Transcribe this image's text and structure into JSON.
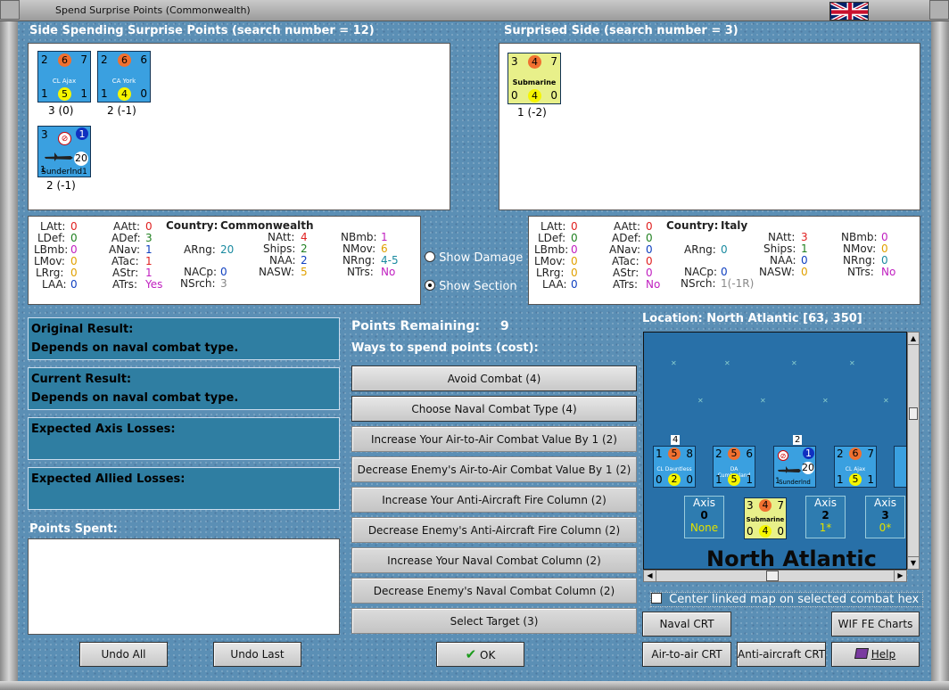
{
  "window": {
    "title": "Spend Surprise Points (Commonwealth)"
  },
  "spending": {
    "header": "Side Spending Surprise Points (search number = 12)",
    "units": [
      {
        "name": "CL Ajax",
        "top": [
          "2",
          "6",
          "7"
        ],
        "bottom": [
          "1",
          "5",
          "1"
        ],
        "count": "3 (0)"
      },
      {
        "name": "CA York",
        "top": [
          "2",
          "6",
          "6"
        ],
        "bottom": [
          "1",
          "4",
          "0"
        ],
        "count": "2 (-1)"
      },
      {
        "name": "Sunderlnd1",
        "top": [
          "3",
          "",
          "1"
        ],
        "bottom": [
          "1",
          "20",
          ""
        ],
        "count": "2 (-1)"
      }
    ]
  },
  "surprised": {
    "header": "Surprised Side (search number = 3)",
    "units": [
      {
        "name": "Submarine",
        "top": [
          "3",
          "4",
          "7"
        ],
        "bottom": [
          "0",
          "4",
          "0"
        ],
        "count": "1 (-2)"
      }
    ]
  },
  "left_stats": {
    "country_label": "Country:",
    "country": "Commonwealth",
    "rows": [
      [
        "LAtt:",
        "0",
        "AAtt:",
        "0",
        "NAtt:",
        "4",
        "NBmb:",
        "1"
      ],
      [
        "LDef:",
        "0",
        "ADef:",
        "3",
        "ARng:",
        "20",
        "Ships:",
        "2",
        "NMov:",
        "6"
      ],
      [
        "LBmb:",
        "0",
        "ANav:",
        "1",
        "NAA:",
        "2",
        "NRng:",
        "4-5"
      ],
      [
        "LMov:",
        "0",
        "ATac:",
        "1",
        "NACp:",
        "0",
        "NASW:",
        "5",
        "NTrs:",
        "No"
      ],
      [
        "LRrg:",
        "0",
        "AStr:",
        "1",
        "NSrch:",
        "3"
      ],
      [
        "LAA:",
        "0",
        "ATrs:",
        "Yes"
      ]
    ]
  },
  "right_stats": {
    "country_label": "Country:",
    "country": "Italy"
  },
  "ls": {
    "LAtt": "LAtt:",
    "LAttv": "0",
    "AAtt": "AAtt:",
    "AAttv": "0",
    "NAtt": "NAtt:",
    "NAttv": "4",
    "NBmb": "NBmb:",
    "NBmbv": "1",
    "LDef": "LDef:",
    "LDefv": "0",
    "ADef": "ADef:",
    "ADefv": "3",
    "Ships": "Ships:",
    "Shipsv": "2",
    "NMov": "NMov:",
    "NMovv": "6",
    "LBmb": "LBmb:",
    "LBmbv": "0",
    "ANav": "ANav:",
    "ANavv": "1",
    "ARng": "ARng:",
    "ARngv": "20",
    "NAA": "NAA:",
    "NAAv": "2",
    "NRng": "NRng:",
    "NRngv": "4-5",
    "LMov": "LMov:",
    "LMovv": "0",
    "ATac": "ATac:",
    "ATacv": "1",
    "NACp": "NACp:",
    "NACpv": "0",
    "NASW": "NASW:",
    "NASWv": "5",
    "NTrs": "NTrs:",
    "NTrsv": "No",
    "LRrg": "LRrg:",
    "LRrgv": "0",
    "AStr": "AStr:",
    "AStrv": "1",
    "LAA": "LAA:",
    "LAAv": "0",
    "ATrs": "ATrs:",
    "ATrsv": "Yes",
    "NSrch": "NSrch:",
    "NSrchv": "3"
  },
  "rs": {
    "LAttv": "0",
    "AAttv": "0",
    "NAttv": "3",
    "NBmbv": "0",
    "LDefv": "0",
    "ADefv": "0",
    "Shipsv": "1",
    "NMovv": "0",
    "LBmbv": "0",
    "ANavv": "0",
    "ARngv": "0",
    "NAAv": "0",
    "NRngv": "0",
    "LMovv": "0",
    "ATacv": "0",
    "NACpv": "0",
    "NASWv": "0",
    "NTrsv": "No",
    "LRrgv": "0",
    "AStrv": "0",
    "LAAv": "0",
    "ATrsv": "No",
    "NSrchv": "1(-1R)"
  },
  "radios": {
    "show_damage": "Show Damage",
    "show_section": "Show Section"
  },
  "results": {
    "original_label": "Original Result:",
    "original_value": "Depends on naval combat type.",
    "current_label": "Current Result:",
    "current_value": "Depends on naval combat type.",
    "axis_losses": "Expected Axis Losses:",
    "allied_losses": "Expected Allied Losses:",
    "points_spent": "Points Spent:"
  },
  "points": {
    "remaining_label": "Points Remaining:",
    "remaining": "9",
    "ways_label": "Ways to spend points (cost):",
    "options": [
      "Avoid Combat (4)",
      "Choose Naval Combat Type (4)",
      "Increase Your Air-to-Air Combat Value By 1 (2)",
      "Decrease Enemy's Air-to-Air Combat Value By 1 (2)",
      "Increase Your Anti-Aircraft Fire Column (2)",
      "Decrease Enemy's Anti-Aircraft Fire Column (2)",
      "Increase Your Naval Combat Column (2)",
      "Decrease Enemy's Naval Combat Column (2)",
      "Select Target (3)"
    ]
  },
  "map": {
    "location": "Location: North Atlantic [63, 350]",
    "sea_name": "North Atlantic",
    "units": [
      {
        "name": "CL Dauntless",
        "top": [
          "1",
          "5",
          "8"
        ],
        "bottom": [
          "0",
          "2",
          "0"
        ],
        "stack": "4"
      },
      {
        "name": "DA Cumberland",
        "top": [
          "2",
          "5",
          "6"
        ],
        "bottom": [
          "1",
          "5",
          "1"
        ],
        "stack": ""
      },
      {
        "name": "Sunderlnd",
        "top": [
          "",
          "",
          "1"
        ],
        "bottom": [
          "1",
          "20",
          ""
        ],
        "stack": "2"
      },
      {
        "name": "CL Ajax",
        "top": [
          "2",
          "6",
          "7"
        ],
        "bottom": [
          "1",
          "5",
          "1"
        ],
        "stack": ""
      }
    ],
    "enemy": {
      "name": "Submarine",
      "top": [
        "3",
        "4",
        "7"
      ],
      "bottom": [
        "0",
        "4",
        "0"
      ]
    },
    "boxes": [
      {
        "side": "Axis",
        "num": "0",
        "val": "None"
      },
      {
        "side": "Axis",
        "num": "2",
        "val": "1*"
      },
      {
        "side": "Axis",
        "num": "3",
        "val": "0*"
      }
    ],
    "center_checkbox": "Center linked map on selected combat hex"
  },
  "buttons": {
    "undo_all": "Undo All",
    "undo_last": "Undo Last",
    "ok": "OK",
    "naval_crt": "Naval CRT",
    "wif_charts": "WIF FE Charts",
    "air_crt": "Air-to-air CRT",
    "aa_crt": "Anti-aircraft CRT",
    "help": "Help"
  },
  "colors": {
    "panel": "#5b8fb5",
    "counter_blue": "#3aa0e0",
    "counter_yellow": "#e8f08a",
    "value_red": "#e02020",
    "value_green": "#208020"
  }
}
